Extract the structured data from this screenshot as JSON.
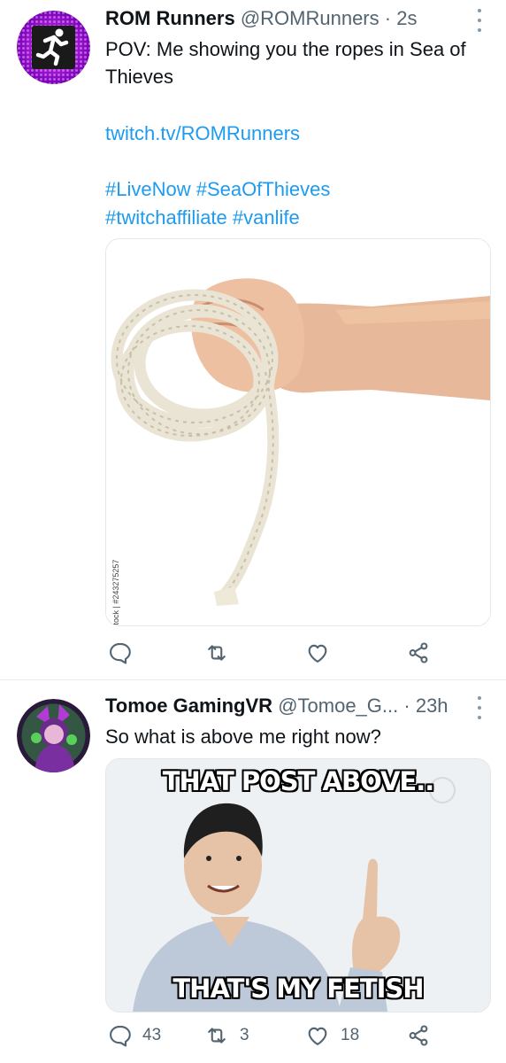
{
  "tweets": [
    {
      "name": "ROM Runners",
      "handle": "@ROMRunners",
      "separator": "·",
      "time": "2s",
      "text": "POV: Me showing you the ropes in Sea of Thieves",
      "link": "twitch.tv/ROMRunners",
      "hashtags_line1": "#LiveNow #SeaOfThieves",
      "hashtags_line2": "#twitchaffiliate #vanlife",
      "media_watermark": "Adobe Stock | #243275257",
      "actions": {
        "reply": "",
        "retweet": "",
        "like": ""
      }
    },
    {
      "name": "Tomoe GamingVR",
      "handle": "@Tomoe_G...",
      "separator": "·",
      "time": "23h",
      "text": "So what is above me right now?",
      "meme_top": "THAT POST ABOVE..",
      "meme_bottom": "THAT'S MY FETISH",
      "actions": {
        "reply": "43",
        "retweet": "3",
        "like": "18"
      }
    }
  ],
  "icons": [
    "avatar-runner",
    "more-icon",
    "reply-icon",
    "retweet-icon",
    "like-icon",
    "share-icon"
  ],
  "colors": {
    "link": "#1d9bf0",
    "secondary": "#536471",
    "avatar1": "#a020d0"
  }
}
